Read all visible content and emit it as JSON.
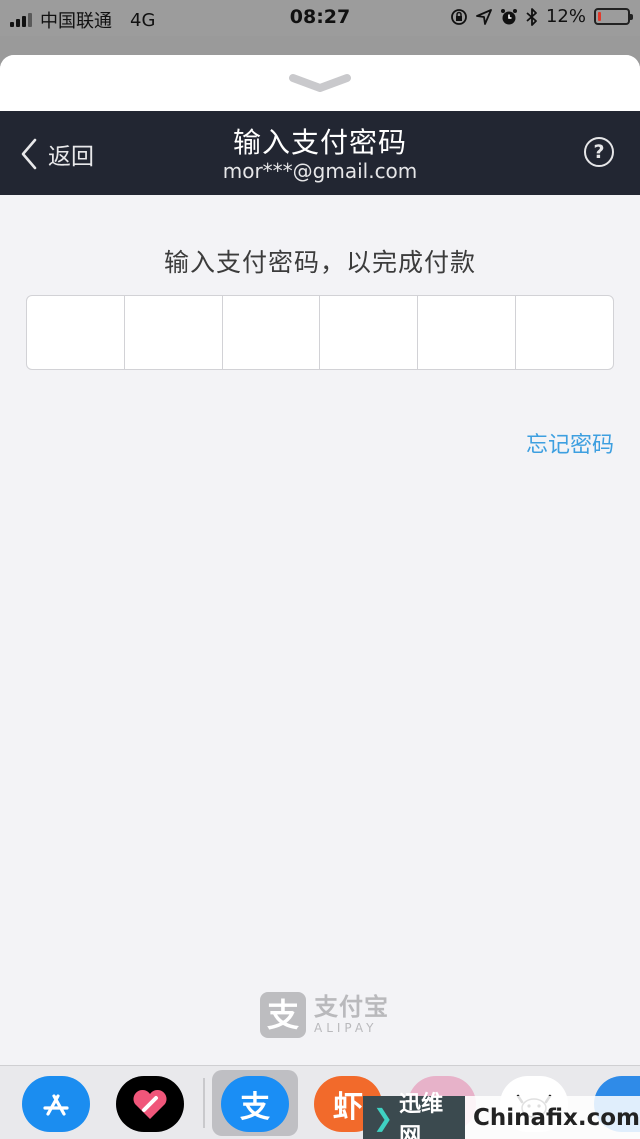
{
  "status_bar": {
    "carrier": "中国联通",
    "network": "4G",
    "time": "08:27",
    "battery": "12%",
    "battery_level": 0.12
  },
  "header": {
    "back_label": "返回",
    "title": "输入支付密码",
    "subtitle": "mor***@gmail.com",
    "help_symbol": "?"
  },
  "main": {
    "prompt": "输入支付密码，以完成付款",
    "pin_digits": 6,
    "forgot_label": "忘记密码"
  },
  "brand": {
    "mark": "支",
    "name_cn": "支付宝",
    "name_en": "ALIPAY"
  },
  "dock": {
    "apps": [
      {
        "icon": "app-store-icon",
        "glyph": "A",
        "color": "#1b8df0"
      },
      {
        "icon": "health-heart-icon",
        "glyph": "♥",
        "color": "#000000"
      },
      {
        "icon": "alipay-icon",
        "glyph": "支",
        "color": "#1a8ef5"
      },
      {
        "icon": "xiami-icon",
        "glyph": "虾",
        "color": "#f26a2b"
      },
      {
        "icon": "pink-app-icon",
        "glyph": "",
        "color": "#e7b2c9"
      },
      {
        "icon": "dog-app-icon",
        "glyph": "",
        "color": "#ffffff"
      },
      {
        "icon": "blue-app-icon",
        "glyph": "",
        "color": "#2f8be8"
      }
    ]
  },
  "watermark": {
    "left_text": "迅维网",
    "right_text": "Chinafix.com"
  },
  "colors": {
    "navbar": "#222632",
    "link": "#3d9fe0",
    "background": "#f3f3f6"
  }
}
